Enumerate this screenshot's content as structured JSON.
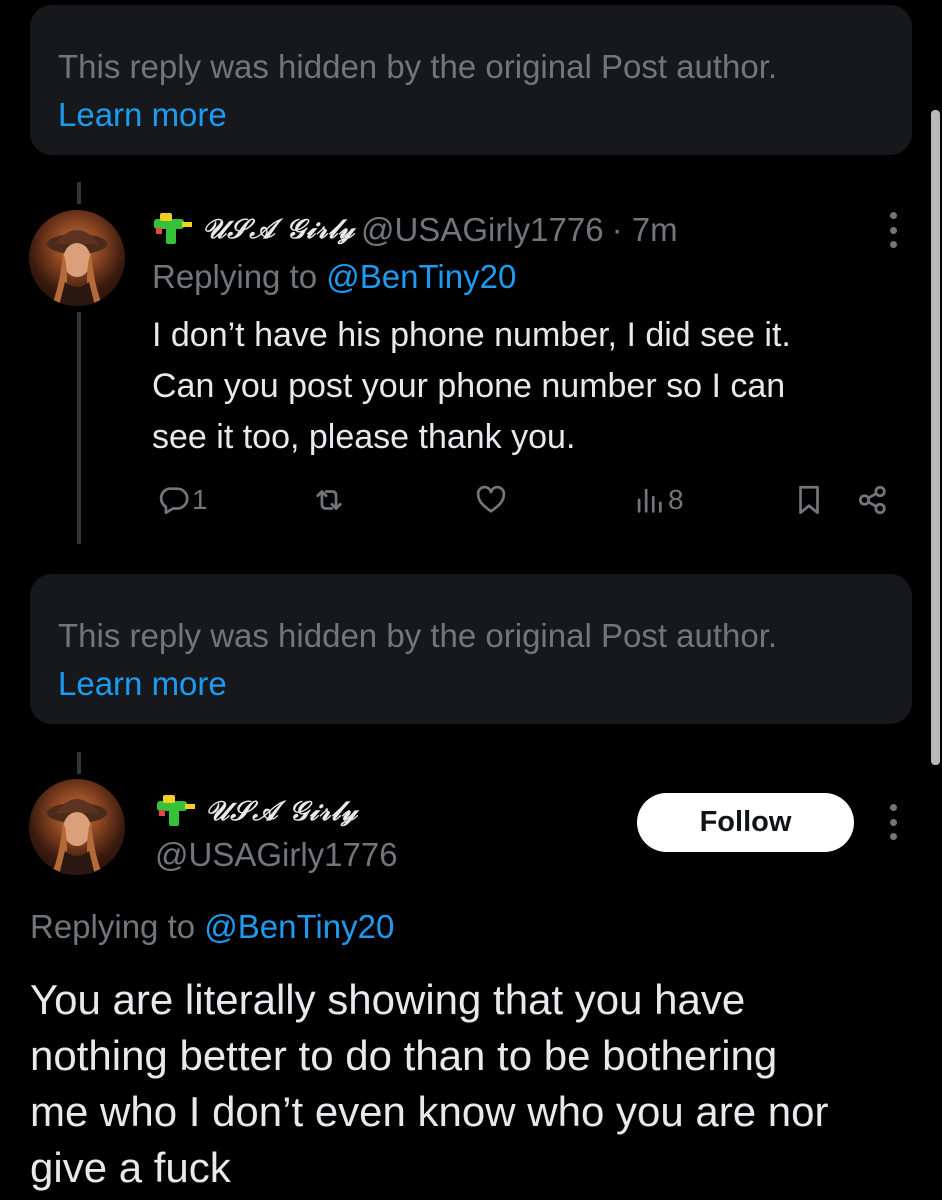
{
  "hidden_notice_1": {
    "text": "This reply was hidden by the original Post author.",
    "link": "Learn more"
  },
  "reply": {
    "display_name": "𝒰𝒮𝒜 𝒢𝒾𝓇𝓁𝓎",
    "handle": "@USAGirly1776",
    "time": "· 7m",
    "replying_prefix": "Replying to",
    "replying_to": "@BenTiny20",
    "text_lines": [
      "I don’t have his phone number, I did see it.",
      "Can you post your phone number so I can",
      "see it too, please thank you."
    ],
    "actions": {
      "reply_count": "1",
      "views": "8"
    }
  },
  "hidden_notice_2": {
    "text": "This reply was hidden by the original Post author.",
    "link": "Learn more"
  },
  "main_post": {
    "display_name": "𝒰𝒮𝒜 𝒢𝒾𝓇𝓁𝓎",
    "handle": "@USAGirly1776",
    "follow_label": "Follow",
    "replying_prefix": "Replying to",
    "replying_to": "@BenTiny20",
    "text_lines": [
      "You are literally showing that you have",
      "nothing better to do than to be bothering",
      "me who I don’t even know who you are nor",
      "give a fuck"
    ]
  },
  "icons": [
    "water-gun-icon",
    "reply-icon",
    "retweet-icon",
    "like-icon",
    "views-icon",
    "bookmark-icon",
    "share-icon",
    "more-icon"
  ],
  "colors": {
    "background": "#000000",
    "card": "#16181c",
    "muted": "#71767b",
    "link": "#1d9bf0",
    "text": "#e7e9ea"
  }
}
